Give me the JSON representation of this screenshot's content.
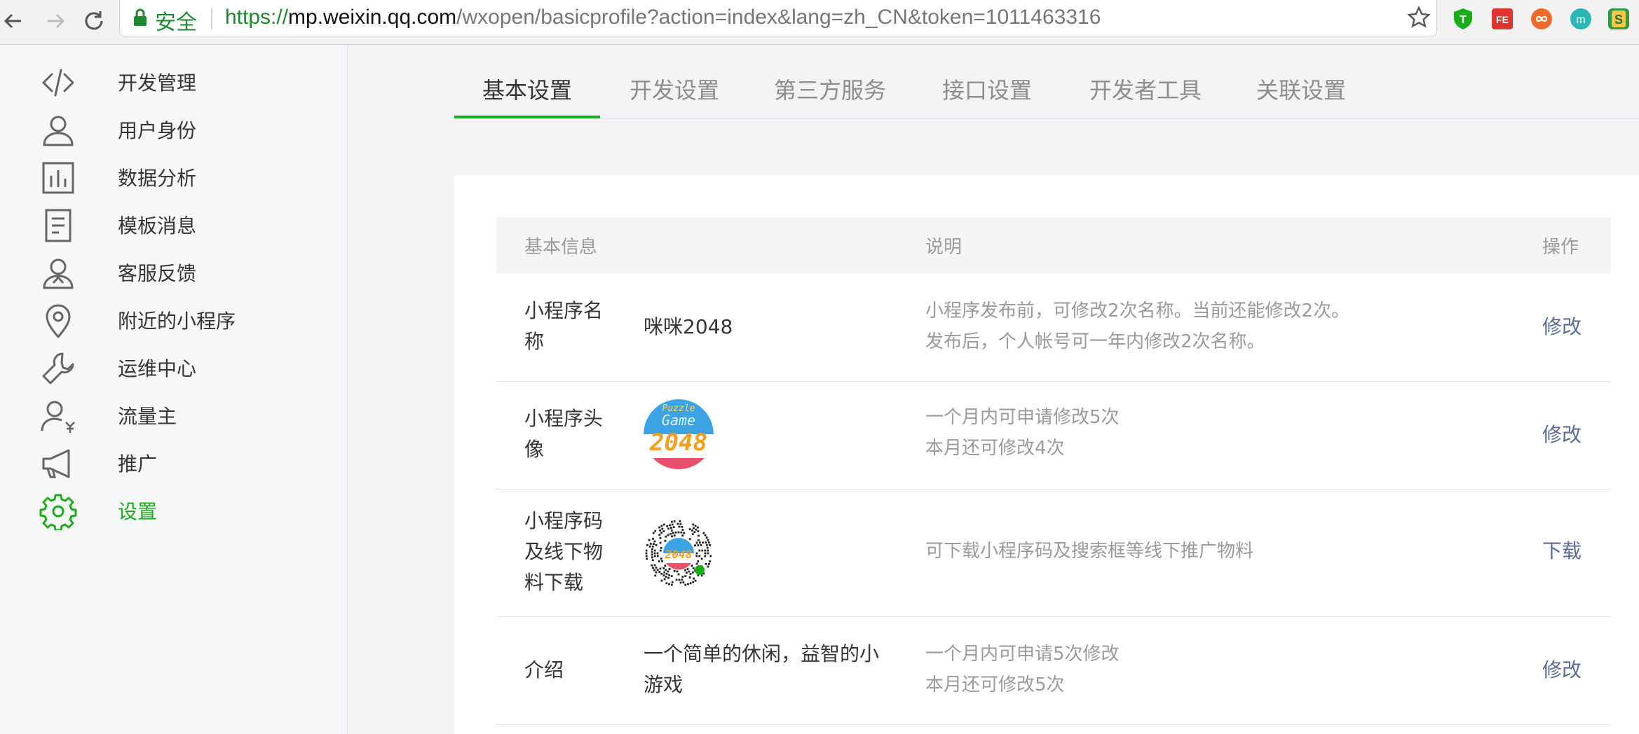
{
  "browser": {
    "secure_label": "安全",
    "url_scheme": "https://",
    "url_host": "mp.weixin.qq.com",
    "url_path": "/wxopen/basicprofile?action=index&lang=zh_CN&token=1011463316",
    "extensions": [
      "shield-ext-icon",
      "fe-ext-icon",
      "infinity-ext-icon",
      "m-ext-icon",
      "s-ext-icon"
    ]
  },
  "sidebar": {
    "items": [
      {
        "label": "开发管理",
        "icon": "code-icon"
      },
      {
        "label": "用户身份",
        "icon": "user-icon"
      },
      {
        "label": "数据分析",
        "icon": "chart-icon"
      },
      {
        "label": "模板消息",
        "icon": "document-icon"
      },
      {
        "label": "客服反馈",
        "icon": "support-icon"
      },
      {
        "label": "附近的小程序",
        "icon": "location-pin-icon"
      },
      {
        "label": "运维中心",
        "icon": "wrench-icon"
      },
      {
        "label": "流量主",
        "icon": "user-yen-icon"
      },
      {
        "label": "推广",
        "icon": "megaphone-icon"
      },
      {
        "label": "设置",
        "icon": "gear-icon",
        "active": true
      }
    ]
  },
  "tabs": [
    {
      "label": "基本设置",
      "active": true
    },
    {
      "label": "开发设置"
    },
    {
      "label": "第三方服务"
    },
    {
      "label": "接口设置"
    },
    {
      "label": "开发者工具"
    },
    {
      "label": "关联设置"
    }
  ],
  "table": {
    "headers": {
      "info": "基本信息",
      "desc": "说明",
      "action": "操作"
    },
    "rows": [
      {
        "label": "小程序名称",
        "value": "咪咪2048",
        "desc1": "小程序发布前，可修改2次名称。当前还能修改2次。",
        "desc2": "发布后，个人帐号可一年内修改2次名称。",
        "action": "修改"
      },
      {
        "label": "小程序头像",
        "avatar_text_top": "Puzzle",
        "avatar_text_mid": "Game",
        "avatar_text_num": "2048",
        "desc1": "一个月内可申请修改5次",
        "desc2": "本月还可修改4次",
        "action": "修改"
      },
      {
        "label": "小程序码及线下物料下载",
        "qr_center_text": "2048",
        "desc1": "可下载小程序码及搜索框等线下推广物料",
        "action": "下载"
      },
      {
        "label": "介绍",
        "value": "一个简单的休闲，益智的小游戏",
        "desc1": "一个月内可申请5次修改",
        "desc2": "本月还可修改5次",
        "action": "修改"
      }
    ]
  },
  "colors": {
    "accent": "#1aad19",
    "link": "#576b95",
    "muted": "#9a9a9a"
  }
}
